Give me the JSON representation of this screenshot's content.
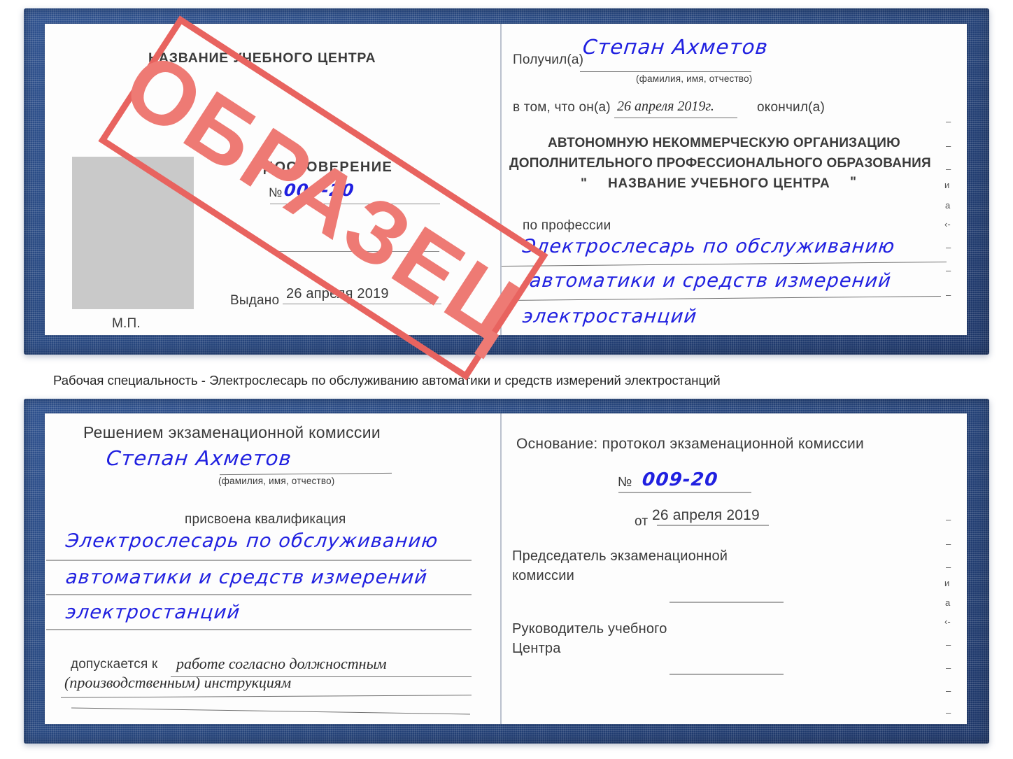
{
  "watermark": {
    "text": "ОБРАЗЕЦ",
    "color": "#e8635f"
  },
  "colors": {
    "cover_blue": "#27477f",
    "ink_blue": "#2020e0",
    "paper": "#fdfdfd",
    "photo_placeholder": "#c9c9c9"
  },
  "caption": "Рабочая специальность - Электрослесарь по обслуживанию автоматики и средств измерений электростанций",
  "certificate_top": {
    "left_page": {
      "org_title": "НАЗВАНИЕ УЧЕБНОГО ЦЕНТРА",
      "doc_type": "УДОСТОВЕРЕНИЕ",
      "number_label": "№",
      "number_value": "009-20",
      "issued_label": "Выдано",
      "issued_value": "26 апреля 2019",
      "seal_label": "М.П.",
      "photo_placeholder": true
    },
    "right_page": {
      "received_label": "Получил(а)",
      "received_value": "Степан Ахметов",
      "name_hint": "(фамилия, имя, отчество)",
      "that_he_label": "в том, что он(а)",
      "that_he_value": "26 апреля 2019г.",
      "graduated_label": "окончил(а)",
      "org_line1": "АВТОНОМНУЮ НЕКОММЕРЧЕСКУЮ ОРГАНИЗАЦИЮ",
      "org_line2": "ДОПОЛНИТЕЛЬНОГО ПРОФЕССИОНАЛЬНОГО ОБРАЗОВАНИЯ",
      "org_quote_open": "\"",
      "org_line3": "НАЗВАНИЕ УЧЕБНОГО ЦЕНТРА",
      "org_quote_close": "\"",
      "profession_label": "по профессии",
      "profession_lines": [
        "Электрослесарь по обслуживанию",
        "автоматики и средств измерений",
        "электростанций"
      ],
      "edge_marks": [
        "–",
        "–",
        "–",
        "и",
        "а",
        "‹-",
        "–",
        "–",
        "–"
      ]
    }
  },
  "certificate_bottom": {
    "left_page": {
      "heading": "Решением экзаменационной комиссии",
      "name_value": "Степан Ахметов",
      "name_hint": "(фамилия, имя, отчество)",
      "qualification_label": "присвоена квалификация",
      "qualification_lines": [
        "Электрослесарь по обслуживанию",
        "автоматики и средств измерений",
        "электростанций"
      ],
      "admitted_label": "допускается к",
      "admitted_value_line1": "работе согласно должностным",
      "admitted_value_line2": "(производственным) инструкциям"
    },
    "right_page": {
      "basis_label": "Основание: протокол экзаменационной комиссии",
      "number_label": "№",
      "number_value": "009-20",
      "date_label": "от",
      "date_value": "26 апреля 2019",
      "chairman_line1": "Председатель экзаменационной",
      "chairman_line2": "комиссии",
      "head_line1": "Руководитель учебного",
      "head_line2": "Центра",
      "edge_marks": [
        "–",
        "–",
        "–",
        "и",
        "а",
        "‹-",
        "–",
        "–",
        "–",
        "–"
      ]
    }
  }
}
